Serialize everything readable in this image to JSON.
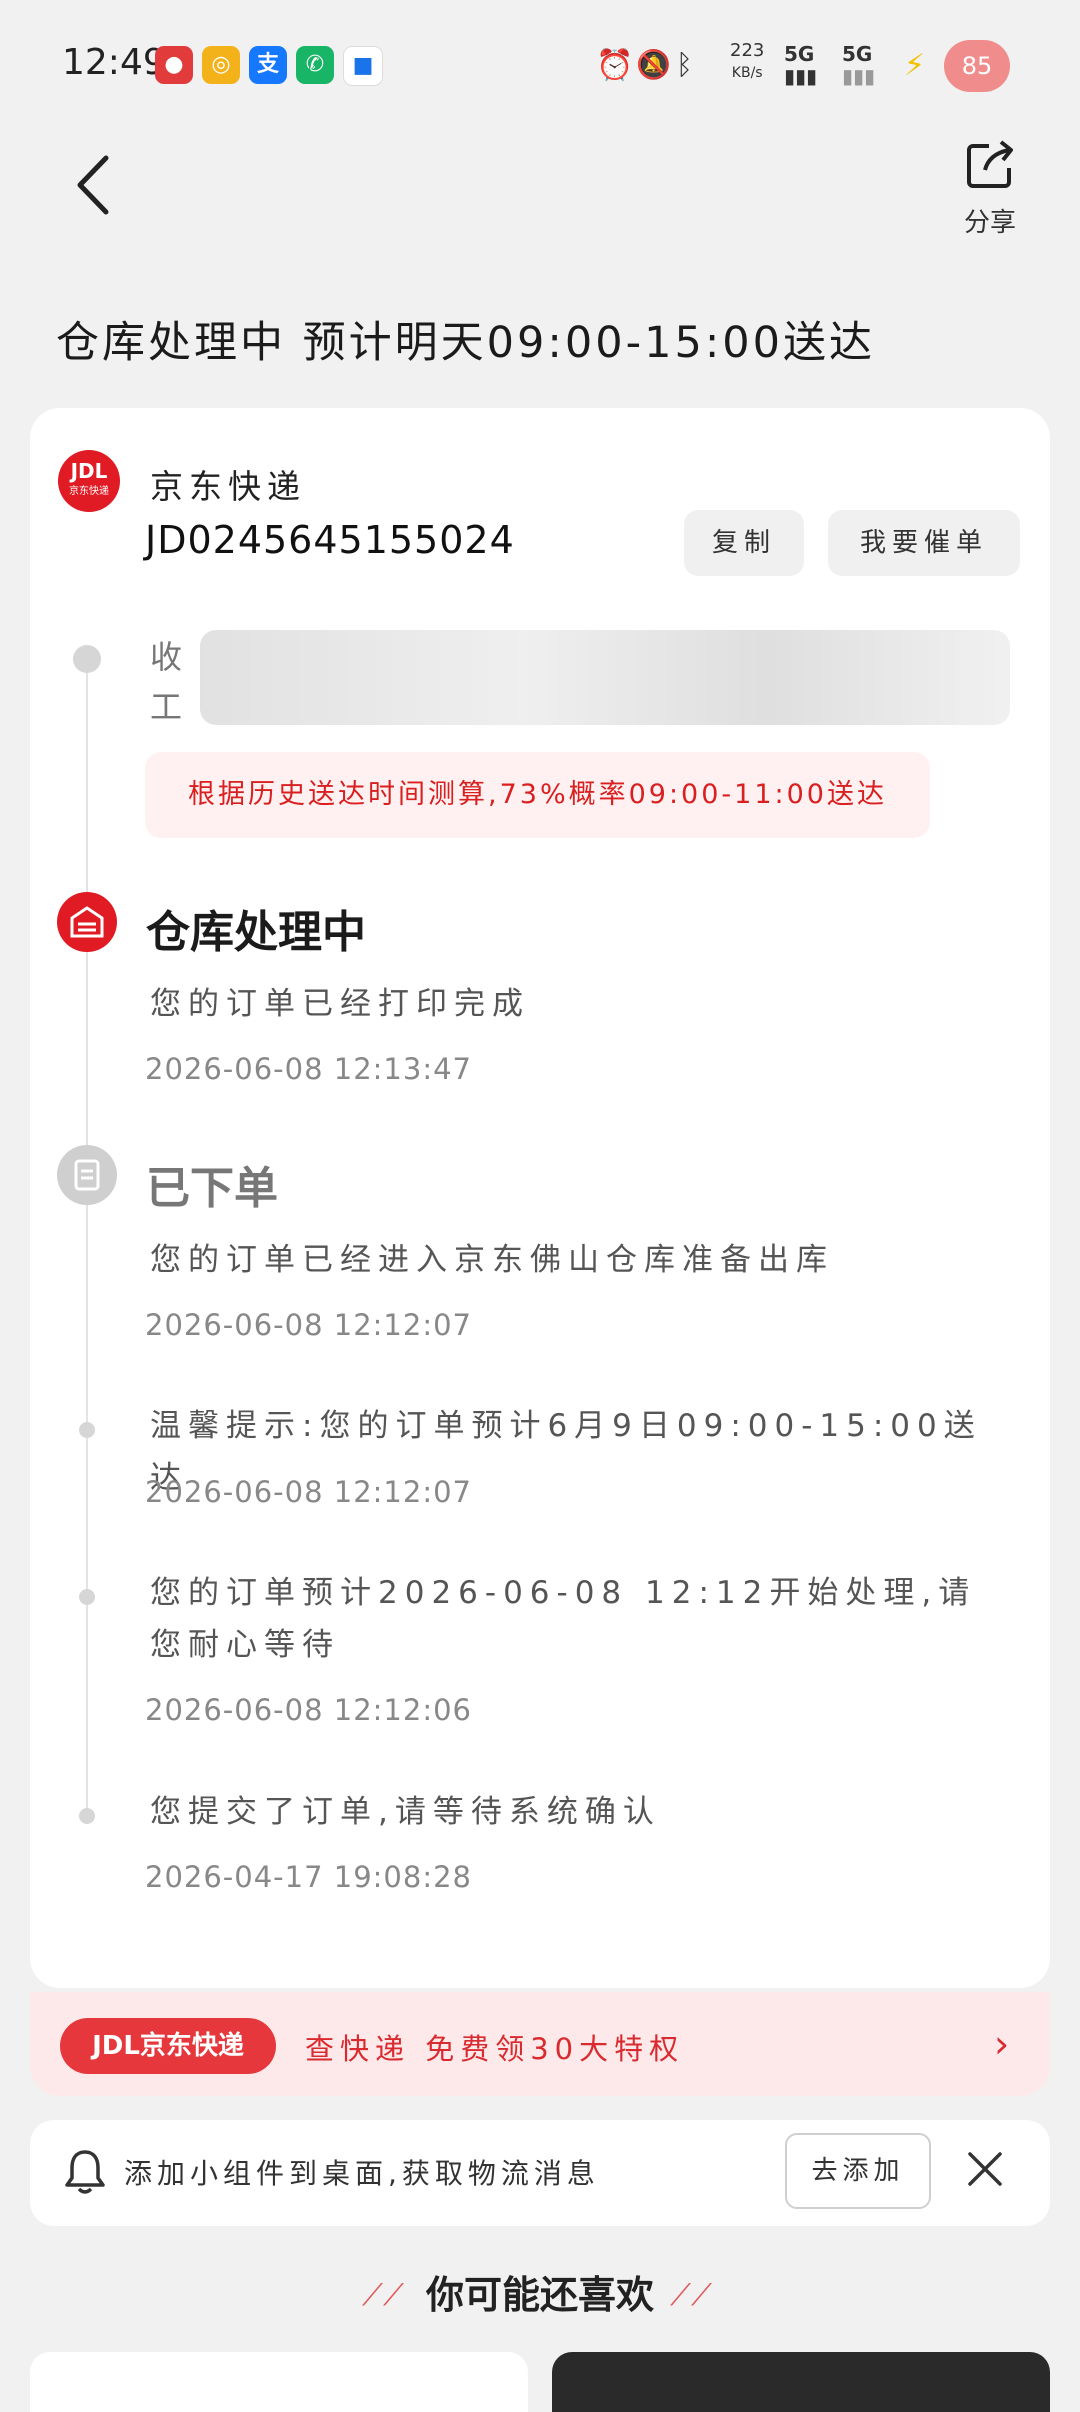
{
  "status_bar": {
    "time": "12:49",
    "speed": "223",
    "speed_unit": "KB/s",
    "network1": "5G",
    "network2": "5G",
    "battery": "85",
    "app_icons": [
      "app-icon",
      "weibo-icon",
      "alipay-icon",
      "phone-icon",
      "app-icon"
    ]
  },
  "header": {
    "share_label": "分享"
  },
  "title": "仓库处理中 预计明天09:00-15:00送达",
  "card": {
    "logo_text": "JDL",
    "logo_sub": "京东快递",
    "carrier": "京东快递",
    "tracking_number": "JD0245645155024",
    "copy_label": "复制",
    "urge_label": "我要催单",
    "address_prefix_1": "收",
    "address_prefix_2": "工",
    "estimate": "根据历史送达时间测算,73%概率09:00-11:00送达",
    "sections": [
      {
        "title": "仓库处理中",
        "text": "您的订单已经打印完成",
        "time": "2026-06-08 12:13:47"
      },
      {
        "title": "已下单",
        "text": "您的订单已经进入京东佛山仓库准备出库",
        "time": "2026-06-08 12:12:07"
      }
    ],
    "events": [
      {
        "text": "温馨提示:您的订单预计6月9日09:00-15:00送达",
        "time": "2026-06-08 12:12:07"
      },
      {
        "text": "您的订单预计2026-06-08 12:12开始处理,请您耐心等待",
        "time": "2026-06-08 12:12:06"
      },
      {
        "text": "您提交了订单,请等待系统确认",
        "time": "2026-04-17 19:08:28"
      }
    ]
  },
  "promo": {
    "badge": "JDL京东快递",
    "text": "查快递 免费领30大特权",
    "arrow": "›"
  },
  "widget": {
    "text": "添加小组件到桌面,获取物流消息",
    "add_label": "去添加"
  },
  "recommend": {
    "title": "你可能还喜欢"
  },
  "colors": {
    "accent": "#e01b24",
    "promo_bg": "#fde9ea",
    "estimate_bg": "#fff1f1"
  }
}
